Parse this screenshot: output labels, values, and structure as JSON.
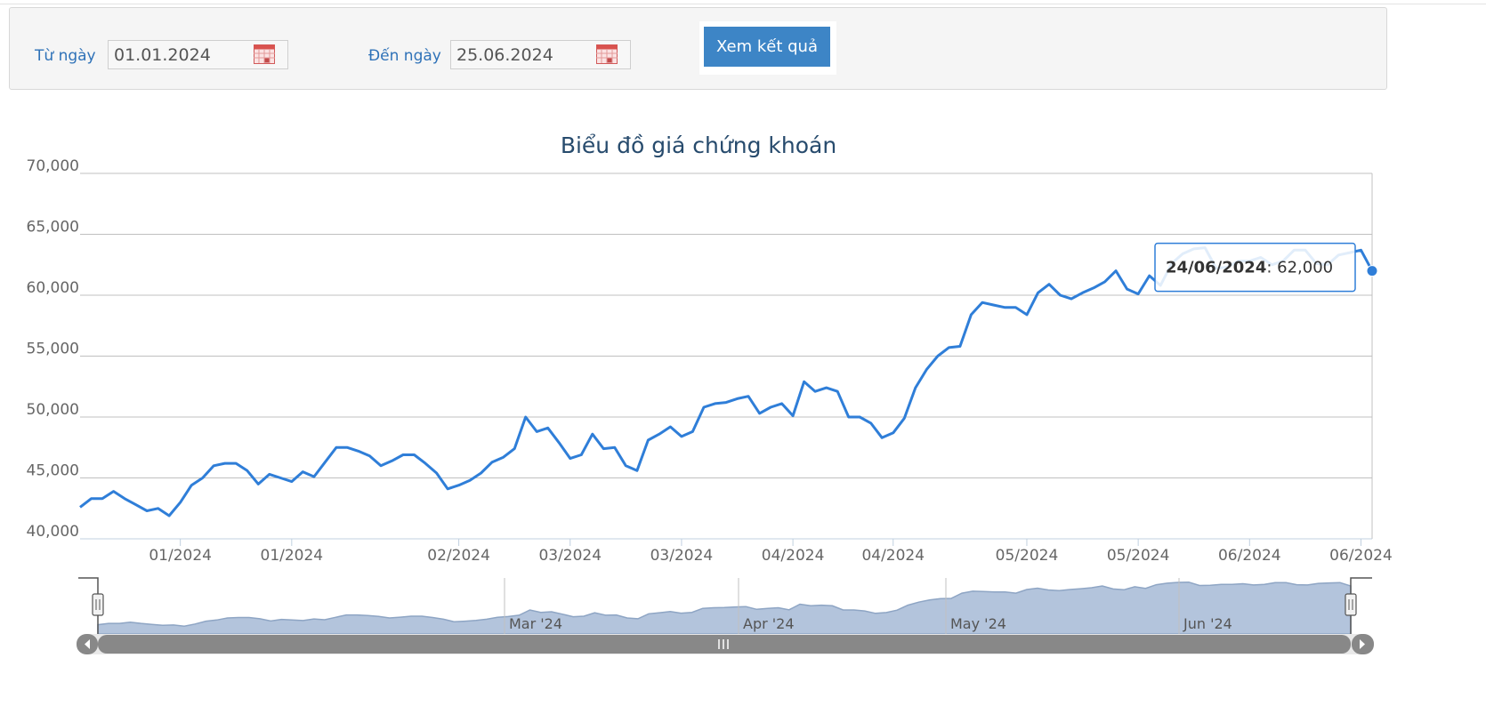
{
  "filter": {
    "from_label": "Từ ngày",
    "from_value": "01.01.2024",
    "to_label": "Đến ngày",
    "to_value": "25.06.2024",
    "submit_label": "Xem kết quả"
  },
  "chart_data": {
    "type": "line",
    "title": "Biểu đồ giá chứng khoán",
    "ylim": [
      40000,
      70000
    ],
    "y_ticks": [
      "40,000",
      "45,000",
      "50,000",
      "55,000",
      "60,000",
      "65,000",
      "70,000"
    ],
    "x_tick_labels": [
      "01/2024",
      "01/2024",
      "02/2024",
      "03/2024",
      "03/2024",
      "04/2024",
      "04/2024",
      "05/2024",
      "05/2024",
      "06/2024",
      "06/2024"
    ],
    "grid": true,
    "color": "#2f7ed8",
    "series": [
      {
        "values": [
          42600,
          43300,
          43300,
          43900,
          43300,
          42800,
          42300,
          42500,
          41900,
          43000,
          44400,
          45000,
          46000,
          46200,
          46200,
          45600,
          44500,
          45300,
          45000,
          44700,
          45500,
          45100,
          46300,
          47500,
          47500,
          47200,
          46800,
          46000,
          46400,
          46900,
          46900,
          46200,
          45400,
          44100,
          44400,
          44800,
          45400,
          46300,
          46700,
          47400,
          50000,
          48800,
          49100,
          47900,
          46600,
          46900,
          48600,
          47400,
          47500,
          46000,
          45600,
          48100,
          48600,
          49200,
          48400,
          48800,
          50800,
          51100,
          51200,
          51500,
          51700,
          50300,
          50800,
          51100,
          50100,
          52900,
          52100,
          52400,
          52100,
          50000,
          50000,
          49500,
          48300,
          48700,
          49900,
          52400,
          53900,
          55000,
          55700,
          55800,
          58400,
          59400,
          59200,
          59000,
          59000,
          58400,
          60200,
          60900,
          60000,
          59700,
          60200,
          60600,
          61100,
          62000,
          60500,
          60100,
          61600,
          60800,
          62600,
          63400,
          63800,
          63900,
          62200,
          62300,
          62800,
          62800,
          63100,
          62500,
          62800,
          63700,
          63700,
          62600,
          62500,
          63300,
          63500,
          63700,
          62000
        ]
      }
    ],
    "tooltip": {
      "date": "24/06/2024",
      "value": "62,000"
    },
    "navigator": {
      "month_labels": [
        "Mar '24",
        "Apr '24",
        "May '24",
        "Jun '24"
      ],
      "fill_color": "#b3c4dc",
      "line_color": "#8ea5c4"
    }
  }
}
